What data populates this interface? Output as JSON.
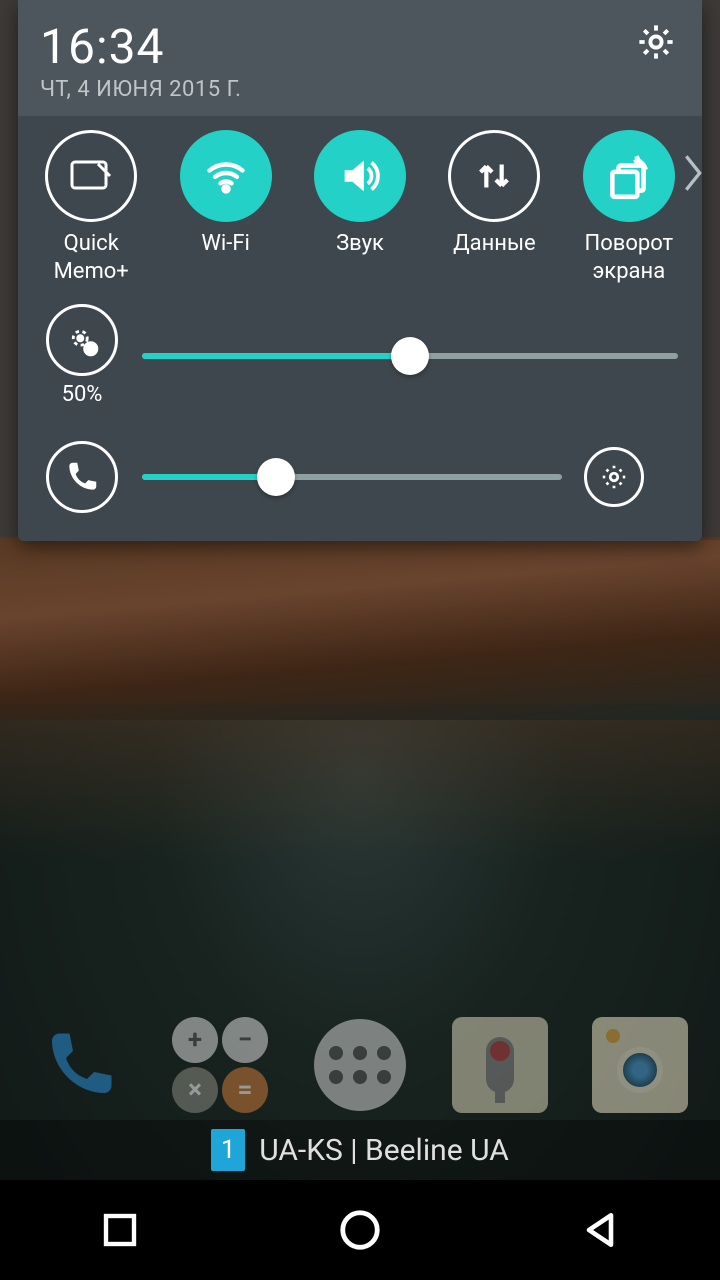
{
  "header": {
    "time": "16:34",
    "date": "ЧТ, 4 ИЮНЯ 2015 Г."
  },
  "toggles": [
    {
      "label": "Quick Memo+",
      "active": false,
      "icon": "memo"
    },
    {
      "label": "Wi-Fi",
      "active": true,
      "icon": "wifi"
    },
    {
      "label": "Звук",
      "active": true,
      "icon": "sound"
    },
    {
      "label": "Данные",
      "active": false,
      "icon": "data"
    },
    {
      "label": "Поворот экрана",
      "active": true,
      "icon": "rotate"
    }
  ],
  "brightness": {
    "percent_label": "50%",
    "value": 50
  },
  "volume": {
    "value": 32
  },
  "carrier": {
    "sim": "1",
    "text": "UA-KS | Beeline UA"
  },
  "colors": {
    "accent": "#24d1c6",
    "panel": "#3e474d",
    "panel_header": "#4d565c"
  }
}
